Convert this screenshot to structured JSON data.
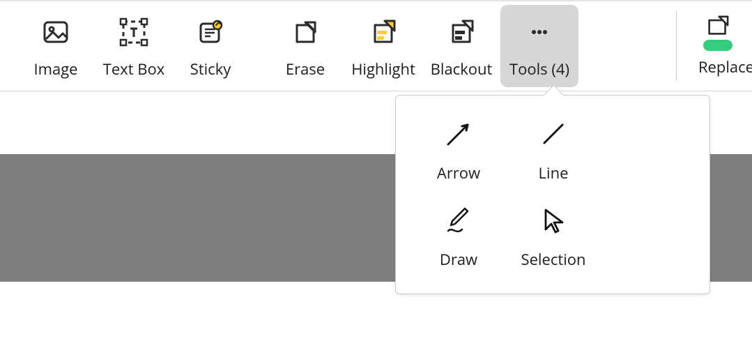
{
  "toolbar": {
    "items": [
      {
        "id": "image",
        "label": "Image"
      },
      {
        "id": "textbox",
        "label": "Text Box"
      },
      {
        "id": "sticky",
        "label": "Sticky"
      },
      {
        "id": "erase",
        "label": "Erase"
      },
      {
        "id": "highlight",
        "label": "Highlight"
      },
      {
        "id": "blackout",
        "label": "Blackout"
      },
      {
        "id": "tools",
        "label": "Tools (4)",
        "active": true
      }
    ],
    "right": {
      "label": "Replace",
      "toggle_on": true
    }
  },
  "tools_popover": {
    "open": true,
    "items": [
      {
        "id": "arrow",
        "label": "Arrow"
      },
      {
        "id": "line",
        "label": "Line"
      },
      {
        "id": "draw",
        "label": "Draw"
      },
      {
        "id": "selection",
        "label": "Selection"
      }
    ]
  }
}
